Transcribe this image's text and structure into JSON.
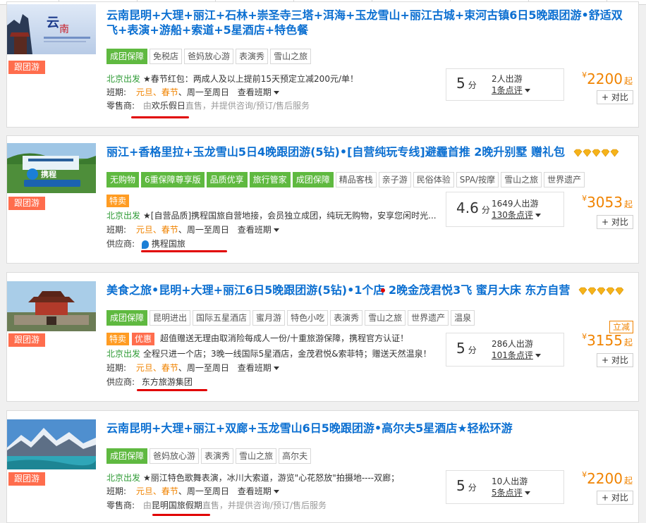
{
  "cards": [
    {
      "badge": "跟团游",
      "title": "云南昆明+大理+丽江+石林+崇圣寺三塔+洱海+玉龙雪山+丽江古城+束河古镇6日5晚跟团游•舒适双飞+表演+游船+索道+5星酒店+特色餐",
      "tags": [
        {
          "label": "成团保障",
          "style": "green"
        },
        {
          "label": "免税店",
          "style": "plain"
        },
        {
          "label": "爸妈放心游",
          "style": "plain"
        },
        {
          "label": "表演秀",
          "style": "plain"
        },
        {
          "label": "雪山之旅",
          "style": "plain"
        }
      ],
      "depart": "北京出发",
      "promo": "★春节红包：两成人及以上提前15天预定立减200元/单！",
      "schedule_label": "班期:",
      "schedule_dates": "元旦、春节",
      "schedule_rest": "、周一至周日",
      "schedule_link": "查看班期",
      "seller_label": "零售商:",
      "seller_prefix": "由",
      "seller_name": "欢乐假日",
      "seller_suffix": "直售，并提供咨询/预订/售后服务",
      "score": "5",
      "score_unit": "分",
      "travelers": "2人出游",
      "reviews": "1条点评",
      "price_currency": "¥",
      "price": "2200",
      "price_suffix": "起",
      "compare": "对比"
    },
    {
      "badge": "跟团游",
      "title": "丽江+香格里拉+玉龙雪山5日4晚跟团游(5钻)•[自营纯玩专线]避霾首推 2晚升别墅 赠礼包",
      "tags": [
        {
          "label": "无购物",
          "style": "green"
        },
        {
          "label": "6重保障尊享版",
          "style": "green"
        },
        {
          "label": "品质优享",
          "style": "green"
        },
        {
          "label": "旅行管家",
          "style": "green"
        },
        {
          "label": "成团保障",
          "style": "green"
        },
        {
          "label": "精品客栈",
          "style": "plain"
        },
        {
          "label": "亲子游",
          "style": "plain"
        },
        {
          "label": "民俗体验",
          "style": "plain"
        },
        {
          "label": "SPA/按摩",
          "style": "plain"
        },
        {
          "label": "雪山之旅",
          "style": "plain"
        },
        {
          "label": "世界遗产",
          "style": "plain"
        }
      ],
      "special_pill": "特卖",
      "depart": "北京出发",
      "promo": "★[自营品质]携程国旅自营地接，会员独立成团，纯玩无购物，安享您闲时光...",
      "schedule_label": "班期:",
      "schedule_dates": "元旦、春节",
      "schedule_rest": "、周一至周日",
      "schedule_link": "查看班期",
      "seller_label": "供应商:",
      "seller_name": "携程国旅",
      "score": "4.6",
      "score_unit": "分",
      "travelers": "1649人出游",
      "reviews": "130条点评",
      "price_currency": "¥",
      "price": "3053",
      "price_suffix": "起",
      "compare": "对比"
    },
    {
      "badge": "跟团游",
      "title": "美食之旅•昆明+大理+丽江6日5晚跟团游(5钻)•1个店 2晚金茂君悦3飞 蜜月大床 东方自营",
      "tags": [
        {
          "label": "成团保障",
          "style": "green"
        },
        {
          "label": "昆明进出",
          "style": "plain"
        },
        {
          "label": "国际五星酒店",
          "style": "plain"
        },
        {
          "label": "蜜月游",
          "style": "plain"
        },
        {
          "label": "特色小吃",
          "style": "plain"
        },
        {
          "label": "表演秀",
          "style": "plain"
        },
        {
          "label": "雪山之旅",
          "style": "plain"
        },
        {
          "label": "世界遗产",
          "style": "plain"
        },
        {
          "label": "温泉",
          "style": "plain"
        }
      ],
      "special_pill": "特卖",
      "discount_pill": "优惠",
      "discount_text": "超值赠送无理由取消险每成人一份/十重旅游保障，携程官方认证！",
      "depart": "北京出发",
      "promo": "全程只进一个店；3晚一线国际5星酒店，金茂君悦&索菲特；赠送天然温泉！",
      "schedule_label": "班期:",
      "schedule_dates": "元旦、春节",
      "schedule_rest": "、周一至周日",
      "schedule_link": "查看班期",
      "seller_label": "供应商:",
      "seller_name": "东方旅游集团",
      "score": "5",
      "score_unit": "分",
      "travelers": "286人出游",
      "reviews": "101条点评",
      "lijian": "立减",
      "price_currency": "¥",
      "price": "3155",
      "price_suffix": "起",
      "compare": "对比"
    },
    {
      "badge": "跟团游",
      "title": "云南昆明+大理+丽江+双廊+玉龙雪山6日5晚跟团游•高尔夫5星酒店★轻松环游",
      "tags": [
        {
          "label": "成团保障",
          "style": "green"
        },
        {
          "label": "爸妈放心游",
          "style": "plain"
        },
        {
          "label": "表演秀",
          "style": "plain"
        },
        {
          "label": "雪山之旅",
          "style": "plain"
        },
        {
          "label": "高尔夫",
          "style": "plain"
        }
      ],
      "depart": "北京出发",
      "promo": "★丽江特色歌舞表演，冰川大索道，游览\"心花怒放\"拍摄地----双廊；",
      "schedule_label": "班期:",
      "schedule_dates": "元旦、春节",
      "schedule_rest": "、周一至周日",
      "schedule_link": "查看班期",
      "seller_label": "零售商:",
      "seller_prefix": "由",
      "seller_name": "昆明国旅假期",
      "seller_suffix": "直售，并提供咨询/预订/售后服务",
      "score": "5",
      "score_unit": "分",
      "travelers": "10人出游",
      "reviews": "5条点评",
      "price_currency": "¥",
      "price": "2200",
      "price_suffix": "起",
      "compare": "对比"
    }
  ]
}
